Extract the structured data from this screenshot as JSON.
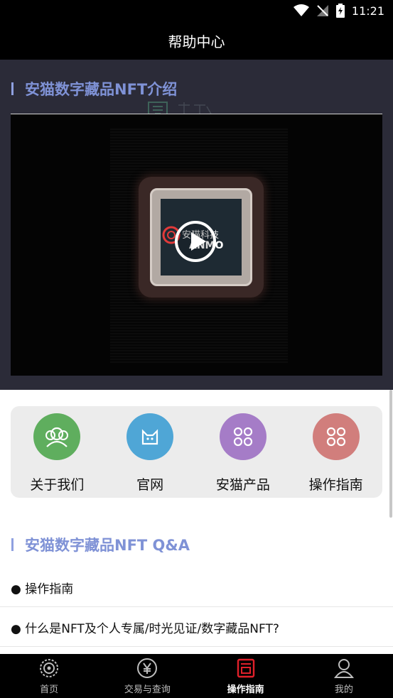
{
  "status_bar": {
    "time": "11:21"
  },
  "header": {
    "title": "帮助中心"
  },
  "intro": {
    "title": "安猫数字藏品NFT介绍"
  },
  "video": {
    "logo_text": "安猫科技",
    "logo_sub": "ANMO"
  },
  "quick_links": [
    {
      "label": "关于我们",
      "icon": "people-icon",
      "color": "#5fae5e"
    },
    {
      "label": "官网",
      "icon": "cat-icon",
      "color": "#4fa6d6"
    },
    {
      "label": "安猫产品",
      "icon": "grid-icon",
      "color": "#a57cc7"
    },
    {
      "label": "操作指南",
      "icon": "grid-icon",
      "color": "#d17e7c"
    }
  ],
  "qa": {
    "title": "安猫数字藏品NFT Q&A",
    "items": [
      {
        "text": "● 操作指南"
      },
      {
        "text": "● 什么是NFT及个人专属/时光见证/数字藏品NFT?"
      }
    ]
  },
  "bottom_nav": [
    {
      "label": "首页",
      "icon": "gear-icon"
    },
    {
      "label": "交易与查询",
      "icon": "yen-icon"
    },
    {
      "label": "操作指南",
      "icon": "guide-icon",
      "active": true,
      "accent": "#e0202a"
    },
    {
      "label": "我的",
      "icon": "user-icon"
    }
  ]
}
